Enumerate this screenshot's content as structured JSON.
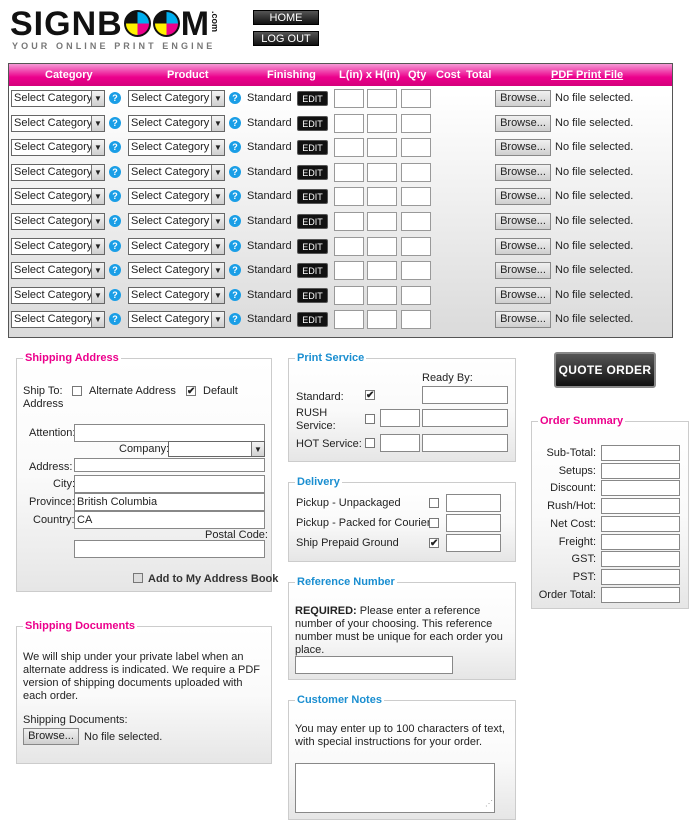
{
  "header": {
    "logo": {
      "brand": "SIGNBOOM",
      "com": ".com",
      "tagline": "YOUR ONLINE PRINT ENGINE"
    },
    "home": "HOME",
    "logout": "LOG OUT"
  },
  "order": {
    "columns": {
      "category": "Category",
      "product": "Product",
      "finishing": "Finishing",
      "dims": "L(in) x H(in)",
      "qty": "Qty",
      "cost": "Cost",
      "total": "Total",
      "pdf": "PDF Print File"
    },
    "rows": [
      {
        "category": "Select Category",
        "product": "Select Category",
        "finishing": "Standard",
        "edit": "EDIT",
        "browse": "Browse...",
        "file": "No file selected."
      },
      {
        "category": "Select Category",
        "product": "Select Category",
        "finishing": "Standard",
        "edit": "EDIT",
        "browse": "Browse...",
        "file": "No file selected."
      },
      {
        "category": "Select Category",
        "product": "Select Category",
        "finishing": "Standard",
        "edit": "EDIT",
        "browse": "Browse...",
        "file": "No file selected."
      },
      {
        "category": "Select Category",
        "product": "Select Category",
        "finishing": "Standard",
        "edit": "EDIT",
        "browse": "Browse...",
        "file": "No file selected."
      },
      {
        "category": "Select Category",
        "product": "Select Category",
        "finishing": "Standard",
        "edit": "EDIT",
        "browse": "Browse...",
        "file": "No file selected."
      },
      {
        "category": "Select Category",
        "product": "Select Category",
        "finishing": "Standard",
        "edit": "EDIT",
        "browse": "Browse...",
        "file": "No file selected."
      },
      {
        "category": "Select Category",
        "product": "Select Category",
        "finishing": "Standard",
        "edit": "EDIT",
        "browse": "Browse...",
        "file": "No file selected."
      },
      {
        "category": "Select Category",
        "product": "Select Category",
        "finishing": "Standard",
        "edit": "EDIT",
        "browse": "Browse...",
        "file": "No file selected."
      },
      {
        "category": "Select Category",
        "product": "Select Category",
        "finishing": "Standard",
        "edit": "EDIT",
        "browse": "Browse...",
        "file": "No file selected."
      },
      {
        "category": "Select Category",
        "product": "Select Category",
        "finishing": "Standard",
        "edit": "EDIT",
        "browse": "Browse...",
        "file": "No file selected."
      }
    ]
  },
  "shipping": {
    "title": "Shipping Address",
    "ship_to": "Ship To: Address",
    "alternate": "Alternate Address",
    "default": "Default",
    "default_checked": true,
    "attention": "Attention:",
    "company": "Company:",
    "address": "Address:",
    "city": "City:",
    "province": "Province:",
    "province_value": "British Columbia",
    "country": "Country:",
    "country_value": "CA",
    "postal": "Postal Code:",
    "add_book": "Add to My Address Book"
  },
  "shipping_docs": {
    "title": "Shipping Documents",
    "text": "We will ship under your private label when an alternate address is indicated. We require a PDF version of shipping documents uploaded with each order.",
    "label": "Shipping Documents:",
    "browse": "Browse...",
    "file": "No file selected."
  },
  "print_service": {
    "title": "Print Service",
    "ready_by": "Ready By:",
    "standard": "Standard:",
    "standard_checked": true,
    "rush": "RUSH Service:",
    "hot": "HOT Service:"
  },
  "delivery": {
    "title": "Delivery",
    "items": [
      {
        "label": "Pickup - Unpackaged",
        "checked": false
      },
      {
        "label": "Pickup - Packed for Courier",
        "checked": false
      },
      {
        "label": "Ship Prepaid Ground",
        "checked": true
      }
    ]
  },
  "reference": {
    "title": "Reference Number",
    "required": "REQUIRED:",
    "text": " Please enter a reference number of your choosing. This reference number must be unique for each order you place."
  },
  "notes": {
    "title": "Customer Notes",
    "text": "You may enter up to 100 characters of text, with special instructions for your order."
  },
  "quote_btn": "QUOTE ORDER",
  "summary": {
    "title": "Order Summary",
    "items": [
      "Sub-Total:",
      "Setups:",
      "Discount:",
      "Rush/Hot:",
      "Net Cost:",
      "Freight:",
      "GST:",
      "PST:",
      "Order Total:"
    ]
  },
  "colors": {
    "accent": "#ec008c",
    "title_blue": "#1a8ed0",
    "help": "#1a9ee6"
  },
  "icons": {
    "help": "help-icon",
    "check": "checkmark-icon",
    "dropdown": "dropdown-arrow-icon"
  }
}
